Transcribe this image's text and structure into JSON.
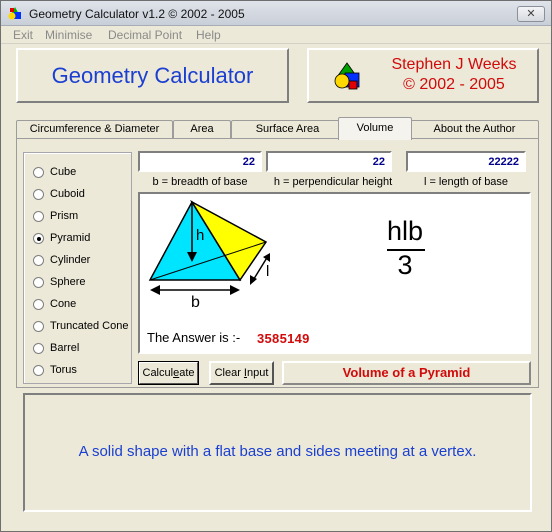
{
  "window": {
    "title": "Geometry Calculator v1.2 ©  2002 - 2005",
    "close_label": "✕"
  },
  "menu": [
    "Exit",
    "Minimise",
    "Decimal Point",
    "Help"
  ],
  "header": {
    "app_name": "Geometry Calculator",
    "author": "Stephen J Weeks",
    "years": "© 2002 - 2005"
  },
  "tabs": [
    {
      "label": "Circumference & Diameter",
      "active": false
    },
    {
      "label": "Area",
      "active": false
    },
    {
      "label": "Surface Area",
      "active": false
    },
    {
      "label": "Volume",
      "active": true
    },
    {
      "label": "About the Author",
      "active": false
    }
  ],
  "shapes": [
    {
      "label": "Cube",
      "checked": false
    },
    {
      "label": "Cuboid",
      "checked": false
    },
    {
      "label": "Prism",
      "checked": false
    },
    {
      "label": "Pyramid",
      "checked": true
    },
    {
      "label": "Cylinder",
      "checked": false
    },
    {
      "label": "Sphere",
      "checked": false
    },
    {
      "label": "Cone",
      "checked": false
    },
    {
      "label": "Truncated Cone",
      "checked": false
    },
    {
      "label": "Barrel",
      "checked": false
    },
    {
      "label": "Torus",
      "checked": false
    }
  ],
  "inputs": {
    "breadth": {
      "value": "22",
      "label": "b = breadth of base"
    },
    "height": {
      "value": "22",
      "label": "h = perpendicular height"
    },
    "length": {
      "value": "22222",
      "label": "l = length of base"
    }
  },
  "diagram": {
    "label_h": "h",
    "label_b": "b",
    "label_l": "l",
    "formula_numerator": "hlb",
    "formula_denominator": "3",
    "answer_label": "The Answer is :-",
    "answer_value": "3585149"
  },
  "buttons": {
    "calculate": "Calculate",
    "calculate_hotkey": "e",
    "clear": "Clear Input",
    "clear_hotkey": "I"
  },
  "shape_title": "Volume of a Pyramid",
  "description": "A solid shape with a flat base and sides meeting at a vertex.",
  "colors": {
    "brand_blue": "#1b3fd1",
    "accent_red": "#d10a0a",
    "pyramid_cyan": "#00e5ff",
    "pyramid_yellow": "#ffff00"
  }
}
